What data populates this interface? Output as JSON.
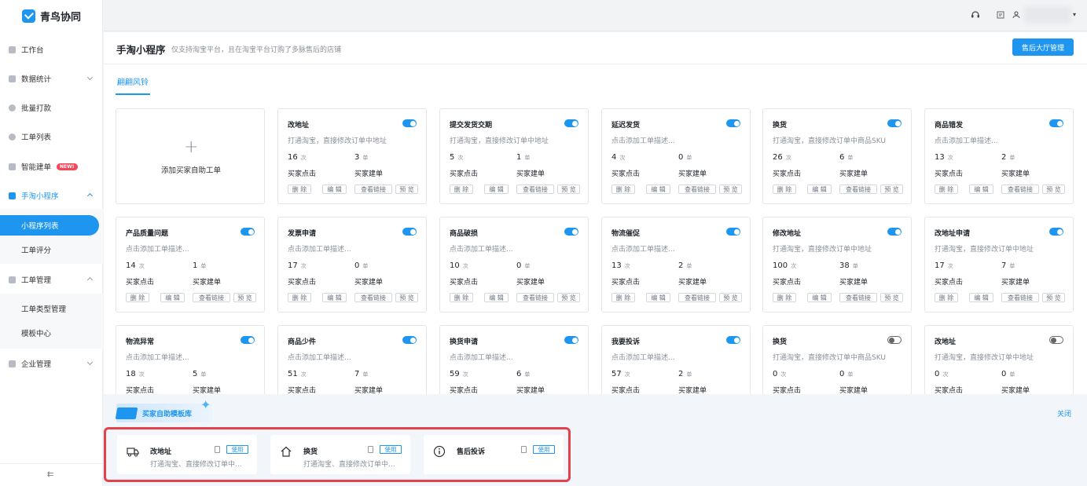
{
  "app": {
    "logo_text": "青鸟协同"
  },
  "sidebar": {
    "items": [
      {
        "label": "工作台",
        "icon": "monitor-icon"
      },
      {
        "label": "数据统计",
        "icon": "bar-chart-icon"
      },
      {
        "label": "批量打款",
        "icon": "coin-icon"
      },
      {
        "label": "工单列表",
        "icon": "search-icon"
      },
      {
        "label": "智能建单",
        "icon": "doc-icon",
        "badge": "NEW!"
      },
      {
        "label": "手淘小程序",
        "icon": "mini-program-icon"
      },
      {
        "label": "工单管理",
        "icon": "ticket-icon"
      },
      {
        "label": "企业管理",
        "icon": "building-icon"
      }
    ],
    "mini_program_sub": [
      {
        "label": "小程序列表"
      },
      {
        "label": "工单评分"
      }
    ],
    "ticket_mgmt_sub": [
      {
        "label": "工单类型管理"
      },
      {
        "label": "模板中心"
      }
    ],
    "collapse_glyph": "⇇"
  },
  "header": {
    "title": "手淘小程序",
    "subtitle": "仅支持淘宝平台，且在淘宝平台订购了多脉售后的店铺",
    "hall_button": "售后大厅管理",
    "shop_tab": "翩翩风铃"
  },
  "add_card": {
    "label": "添加买家自助工单",
    "plus": "+"
  },
  "stat_labels": {
    "clicks": "买家点击",
    "tickets": "买家建单",
    "unit_clicks": "次",
    "unit_tickets": "单"
  },
  "card_buttons": {
    "delete": "删 除",
    "edit": "编 辑",
    "link": "查看链接",
    "preview": "预 览"
  },
  "cards": [
    {
      "title": "改地址",
      "desc": "打通淘宝，直接修改订单中地址",
      "clicks": "16",
      "tickets": "3",
      "enabled": true
    },
    {
      "title": "提交发货交期",
      "desc": "打通淘宝，直接修改订单中地址",
      "clicks": "5",
      "tickets": "1",
      "enabled": true
    },
    {
      "title": "延迟发货",
      "desc": "点击添加工单描述...",
      "clicks": "4",
      "tickets": "0",
      "enabled": true
    },
    {
      "title": "换货",
      "desc": "打通淘宝，直接修改订单中商品SKU",
      "clicks": "26",
      "tickets": "6",
      "enabled": true
    },
    {
      "title": "商品错发",
      "desc": "点击添加工单描述...",
      "clicks": "13",
      "tickets": "2",
      "enabled": true
    },
    {
      "title": "产品质量问题",
      "desc": "点击添加工单描述...",
      "clicks": "14",
      "tickets": "1",
      "enabled": true
    },
    {
      "title": "发票申请",
      "desc": "点击添加工单描述...",
      "clicks": "17",
      "tickets": "0",
      "enabled": true
    },
    {
      "title": "商品破损",
      "desc": "点击添加工单描述...",
      "clicks": "10",
      "tickets": "0",
      "enabled": true
    },
    {
      "title": "物流催促",
      "desc": "点击添加工单描述...",
      "clicks": "13",
      "tickets": "2",
      "enabled": true
    },
    {
      "title": "修改地址",
      "desc": "打通淘宝，直接修改订单中地址",
      "clicks": "100",
      "tickets": "38",
      "enabled": true
    },
    {
      "title": "改地址申请",
      "desc": "打通淘宝，直接修改订单中地址",
      "clicks": "17",
      "tickets": "7",
      "enabled": true
    },
    {
      "title": "物流异常",
      "desc": "点击添加工单描述...",
      "clicks": "18",
      "tickets": "5",
      "enabled": true
    },
    {
      "title": "商品少件",
      "desc": "点击添加工单描述...",
      "clicks": "51",
      "tickets": "7",
      "enabled": true
    },
    {
      "title": "换货申请",
      "desc": "点击添加工单描述...",
      "clicks": "59",
      "tickets": "6",
      "enabled": true
    },
    {
      "title": "我要投诉",
      "desc": "点击添加工单描述...",
      "clicks": "57",
      "tickets": "2",
      "enabled": true
    },
    {
      "title": "换货",
      "desc": "打通淘宝，直接修改订单中商品SKU",
      "clicks": "0",
      "tickets": "0",
      "enabled": false
    },
    {
      "title": "改地址",
      "desc": "打通淘宝，直接修改订单中地址",
      "clicks": "0",
      "tickets": "0",
      "enabled": false
    }
  ],
  "library": {
    "title": "买家自助模板库",
    "close": "关闭",
    "use_label": "使用",
    "templates": [
      {
        "name": "改地址",
        "desc": "打通淘宝、直接修改订单中...",
        "icon": "truck-icon"
      },
      {
        "name": "换货",
        "desc": "打通淘宝、直接修改订单中...",
        "icon": "home-icon"
      },
      {
        "name": "售后投诉",
        "desc": "",
        "icon": "info-icon"
      }
    ]
  },
  "colors": {
    "accent": "#1e96f0",
    "highlight_frame": "#e2434b",
    "new_badge": "#f5475a"
  }
}
